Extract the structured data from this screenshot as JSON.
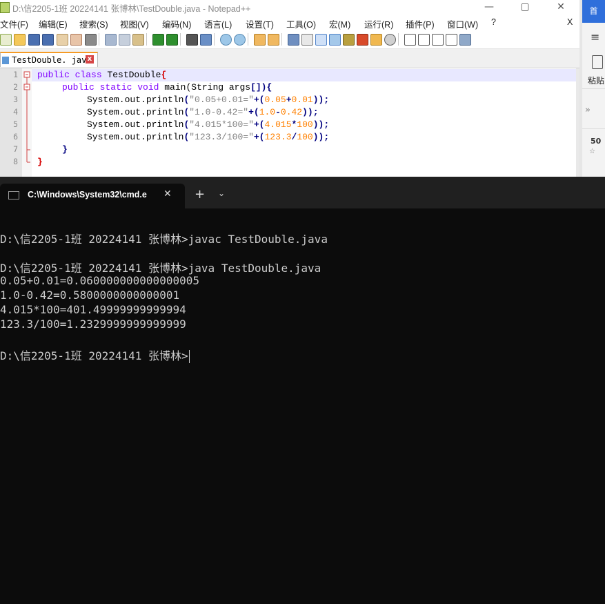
{
  "npp": {
    "title": "D:\\信2205-1班 20224141 张博林\\TestDouble.java - Notepad++",
    "window_buttons": {
      "minimize": "—",
      "maximize": "▢",
      "close": "✕"
    },
    "menu": [
      "文件(F)",
      "编辑(E)",
      "搜索(S)",
      "视图(V)",
      "编码(N)",
      "语言(L)",
      "设置(T)",
      "工具(O)",
      "宏(M)",
      "运行(R)",
      "插件(P)",
      "窗口(W)",
      "?"
    ],
    "menu_close": "X",
    "tab_label": "TestDouble. java",
    "line_numbers": [
      "1",
      "2",
      "3",
      "4",
      "5",
      "6",
      "7",
      "8"
    ],
    "code": {
      "l1_kw": "public class",
      "l1_name": " TestDouble",
      "l1_brace": "{",
      "l2_kw": "public static void",
      "l2_rest": " main(String args",
      "l2_br": "[])",
      "l2_brace": "{",
      "print_prefix": "System.out.println",
      "l3_str": "\"0.05+0.01=\"",
      "l3_a": "0.05",
      "l3_b": "0.01",
      "l4_str": "\"1.0-0.42=\"",
      "l4_a": "1.0",
      "l4_b": "0.42",
      "l5_str": "\"4.015*100=\"",
      "l5_a": "4.015",
      "l5_b": "100",
      "l6_str": "\"123.3/100=\"",
      "l6_a": "123.3",
      "l6_b": "100",
      "l7_brace": "}",
      "l8_brace": "}"
    }
  },
  "right_app": {
    "top_label": "首",
    "menu_icon": "≡",
    "paste_label": "粘贴",
    "chevron": "»",
    "num": "50",
    "star": "☆"
  },
  "terminal": {
    "tab_title": "C:\\Windows\\System32\\cmd.e",
    "tab_close": "✕",
    "new_tab": "+",
    "dropdown": "⌄",
    "lines": [
      "D:\\信2205-1班 20224141 张博林>javac TestDouble.java",
      "D:\\信2205-1班 20224141 张博林>java TestDouble.java",
      "0.05+0.01=0.060000000000000005",
      "1.0-0.42=0.5800000000000001",
      "4.015*100=401.49999999999994",
      "123.3/100=1.2329999999999999",
      "D:\\信2205-1班 20224141 张博林>"
    ]
  }
}
